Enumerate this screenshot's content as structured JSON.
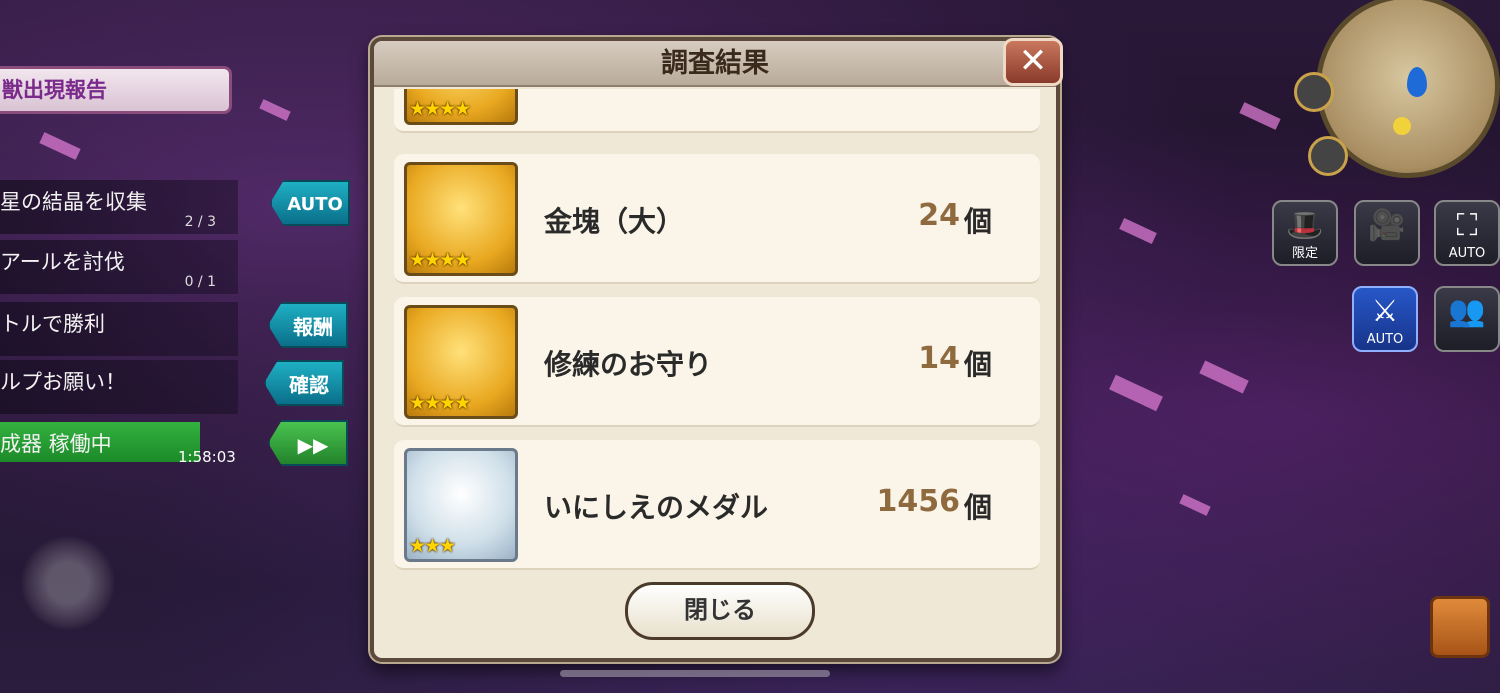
{
  "colors": {
    "dialog_bg": "#efe8d6",
    "accent_qty": "#8e6a3e",
    "star": "#ffd400"
  },
  "quest_panel": {
    "report_banner": "獣出現報告",
    "quests": [
      {
        "text": "星の結晶を収集",
        "count": "2 / 3"
      },
      {
        "text": "アールを討伐",
        "count": "0 / 1"
      },
      {
        "text": "トルで勝利",
        "count": ""
      },
      {
        "text": "ルプお願い！",
        "count": ""
      },
      {
        "text": "成器 稼働中",
        "count": ""
      }
    ],
    "timer": "1:58:03",
    "buttons": {
      "auto": "AUTO",
      "reward": "報酬",
      "confirm": "確認",
      "fast_forward": "▶▶"
    }
  },
  "hud": {
    "limited_label": "限定",
    "auto_label_1": "AUTO",
    "auto_label_2": "AUTO",
    "camera_icon": "camera-icon",
    "party_icon": "party-icon",
    "chest_icon": "treasure-chest-icon"
  },
  "dialog": {
    "title": "調査結果",
    "close_x": "✕",
    "items": [
      {
        "name": "金塊（大）",
        "qty": "24",
        "unit": "個",
        "stars": "★★★★",
        "icon": "gold-bars-icon"
      },
      {
        "name": "修練のお守り",
        "qty": "14",
        "unit": "個",
        "stars": "★★★★",
        "icon": "amulet-icon"
      },
      {
        "name": "いにしえのメダル",
        "qty": "1456",
        "unit": "個",
        "stars": "★★★",
        "icon": "ancient-medal-icon"
      }
    ],
    "partial_stars": "★★★★",
    "close_button": "閉じる"
  }
}
